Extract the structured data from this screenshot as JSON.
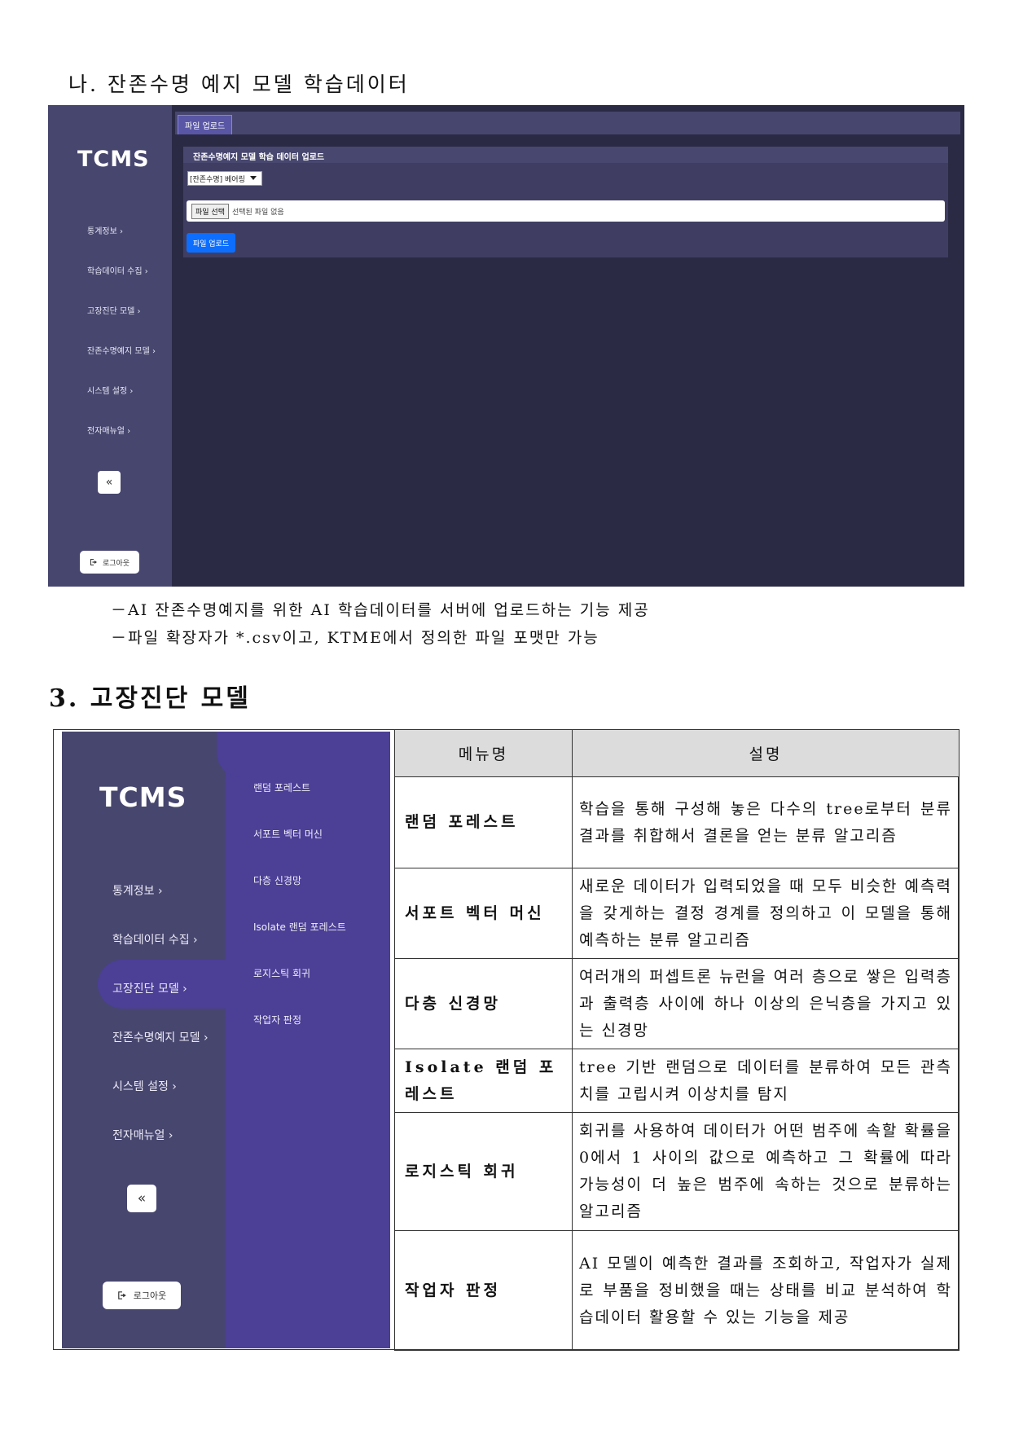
{
  "headings": {
    "subsection": "나. 잔존수명 예지 모델 학습데이터",
    "section3": "3. 고장진단 모델"
  },
  "bullets": [
    "－AI 잔존수명예지를 위한 AI 학습데이터를 서버에 업로드하는 기능 제공",
    "－파일 확장자가 *.csv이고, KTME에서 정의한 파일 포맷만 가능"
  ],
  "shot1": {
    "logo": "TCMS",
    "nav": [
      "통계정보 ›",
      "학습데이터 수집 ›",
      "고장진단 모델 ›",
      "잔존수명예지 모델 ›",
      "시스템 설정 ›",
      "전자매뉴얼 ›"
    ],
    "collapse": "«",
    "logout": "로그아웃",
    "tab": "파일 업로드",
    "panel_title": "잔존수명예지 모델 학습 데이터 업로드",
    "select_value": "[잔존수명] 베어링",
    "file_button": "파일 선택",
    "file_status": "선택된 파일 없음",
    "upload_button": "파일 업로드"
  },
  "shot2": {
    "logo": "TCMS",
    "nav": [
      "통계정보 ›",
      "학습데이터 수집 ›",
      "고장진단 모델 ›",
      "잔존수명예지 모델 ›",
      "시스템 설정 ›",
      "전자매뉴얼 ›"
    ],
    "submenu": [
      "랜덤 포레스트",
      "서포트 벡터 머신",
      "다층 신경망",
      "Isolate 랜덤 포레스트",
      "로지스틱 회귀",
      "작업자 판정"
    ],
    "collapse": "«",
    "logout": "로그아웃"
  },
  "table": {
    "headers": [
      "메뉴명",
      "설명"
    ],
    "rows": [
      {
        "name": "랜덤 포레스트",
        "desc": "학습을 통해 구성해 놓은 다수의 tree로부터 분류 결과를 취합해서 결론을 얻는 분류 알고리즘"
      },
      {
        "name": "서포트 벡터 머신",
        "desc": "새로운 데이터가 입력되었을 때 모두 비슷한 예측력을 갖게하는 결정 경계를 정의하고 이 모델을 통해 예측하는 분류 알고리즘"
      },
      {
        "name": "다층 신경망",
        "desc": "여러개의 퍼셉트론 뉴런을 여러 층으로 쌓은 입력층과 출력층 사이에 하나 이상의 은닉층을 가지고 있는 신경망"
      },
      {
        "name": "Isolate 랜덤 포레스트",
        "desc": "tree 기반 랜덤으로 데이터를 분류하여 모든 관측치를 고립시켜 이상치를 탐지"
      },
      {
        "name": "로지스틱 회귀",
        "desc": "회귀를 사용하여 데이터가 어떤 범주에 속할 확률을 0에서 1 사이의 값으로 예측하고 그 확률에 따라 가능성이 더 높은 범주에 속하는 것으로 분류하는 알고리즘"
      },
      {
        "name": "작업자 판정",
        "desc": "AI 모델이 예측한 결과를 조회하고, 작업자가 실제로 부품을 정비했을 때는 상태를 비교 분석하여 학습데이터 활용할 수 있는 기능을 제공"
      }
    ]
  }
}
